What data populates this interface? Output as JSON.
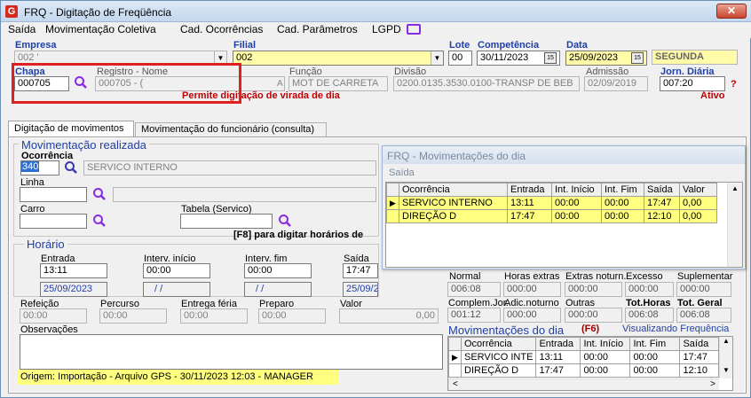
{
  "window": {
    "title": "FRQ - Digitação de Freqüência",
    "close": "✕"
  },
  "menu": [
    "Saída",
    "Movimentação Coletiva",
    "Cad. Ocorrências",
    "Cad. Parâmetros",
    "LGPD"
  ],
  "empresa": {
    "label": "Empresa",
    "value": "002 '"
  },
  "filial": {
    "label": "Filial",
    "value": "002"
  },
  "lote": {
    "label": "Lote",
    "value": "00"
  },
  "competencia": {
    "label": "Competência",
    "value": "30/11/2023"
  },
  "data": {
    "label": "Data",
    "value": "25/09/2023",
    "weekday": "SEGUNDA"
  },
  "chapa": {
    "label": "Chapa",
    "value": "000705"
  },
  "registro": {
    "label": "Registro - Nome",
    "value": "000705 - ("
  },
  "funcao": {
    "label": "Função",
    "value": "MOT DE CARRETA"
  },
  "divisao": {
    "label": "Divisão",
    "value": "0200.0135.3530.0100-TRANSP DE BEB"
  },
  "admissao": {
    "label": "Admissão",
    "value": "02/09/2019"
  },
  "jornada": {
    "label": "Jorn. Diária",
    "value": "007:20",
    "help": "?"
  },
  "notice": "Permite digitação de virada de dia",
  "status": "Ativo",
  "tabs": [
    "Digitação de movimentos",
    "Movimentação do funcionário (consulta)"
  ],
  "movreal": {
    "title": "Movimentação realizada",
    "ocorrencia_label": "Ocorrência",
    "ocorrencia_code": "340",
    "ocorrencia_desc": "SERVICO INTERNO",
    "linha_label": "Linha",
    "carro_label": "Carro",
    "tabela_label": "Tabela (Servico)",
    "f8_hint": "[F8] para digitar horários de"
  },
  "horario": {
    "title": "Horário",
    "entrada_label": "Entrada",
    "entrada": "13:11",
    "entrada_date": "25/09/2023",
    "interv_ini_label": "Interv. início",
    "interv_ini": "00:00",
    "interv_ini_date": "/ /",
    "interv_fim_label": "Interv. fim",
    "interv_fim": "00:00",
    "interv_fim_date": "/ /",
    "saida_label": "Saída",
    "saida": "17:47",
    "saida_date": "25/09/2023"
  },
  "extras": {
    "refeicao_label": "Refeição",
    "refeicao": "00:00",
    "percurso_label": "Percurso",
    "percurso": "00:00",
    "entrega_label": "Entrega féria",
    "entrega": "00:00",
    "preparo_label": "Preparo",
    "preparo": "00:00",
    "valor_label": "Valor",
    "valor": "0,00"
  },
  "obs": {
    "label": "Observações",
    "origem": "Origem: Importação - Arquivo GPS - 30/11/2023 12:03 - MANAGER"
  },
  "popup": {
    "title": "FRQ - Movimentações do dia",
    "menu": "Saída",
    "headers": [
      "Ocorrência",
      "Entrada",
      "Int. Início",
      "Int. Fim",
      "Saída",
      "Valor"
    ],
    "rows": [
      [
        "SERVICO INTERNO",
        "13:11",
        "00:00",
        "00:00",
        "17:47",
        "0,00"
      ],
      [
        "DIREÇÃO D",
        "17:47",
        "00:00",
        "00:00",
        "12:10",
        "0,00"
      ]
    ]
  },
  "totais": {
    "normal_label": "Normal",
    "normal": "006:08",
    "hextras_label": "Horas extras",
    "hextras": "000:00",
    "extnot_label": "Extras noturn.",
    "extnot": "000:00",
    "excesso_label": "Excesso",
    "excesso": "000:00",
    "supl_label": "Suplementar",
    "supl": "000:00",
    "compl_label": "Complem.Jor.",
    "compl": "001:12",
    "adic_label": "Adic.noturno",
    "adic": "000:00",
    "outras_label": "Outras",
    "outras": "000:00",
    "toth_label": "Tot.Horas",
    "toth": "006:08",
    "totg_label": "Tot. Geral",
    "totg": "006:08"
  },
  "movdia": {
    "title": "Movimentações do dia",
    "key": "(F6)",
    "link": "Visualizando Frequência",
    "headers": [
      "Ocorrência",
      "Entrada",
      "Int. Início",
      "Int. Fim",
      "Saída"
    ],
    "rows": [
      [
        "SERVICO INTE",
        "13:11",
        "00:00",
        "00:00",
        "17:47"
      ],
      [
        "DIREÇÃO D",
        "17:47",
        "00:00",
        "00:00",
        "12:10"
      ]
    ]
  },
  "colors": {
    "label_blue": "#1f3fa6",
    "highlight_red": "#e02020",
    "row_yellow": "#ffff80"
  }
}
